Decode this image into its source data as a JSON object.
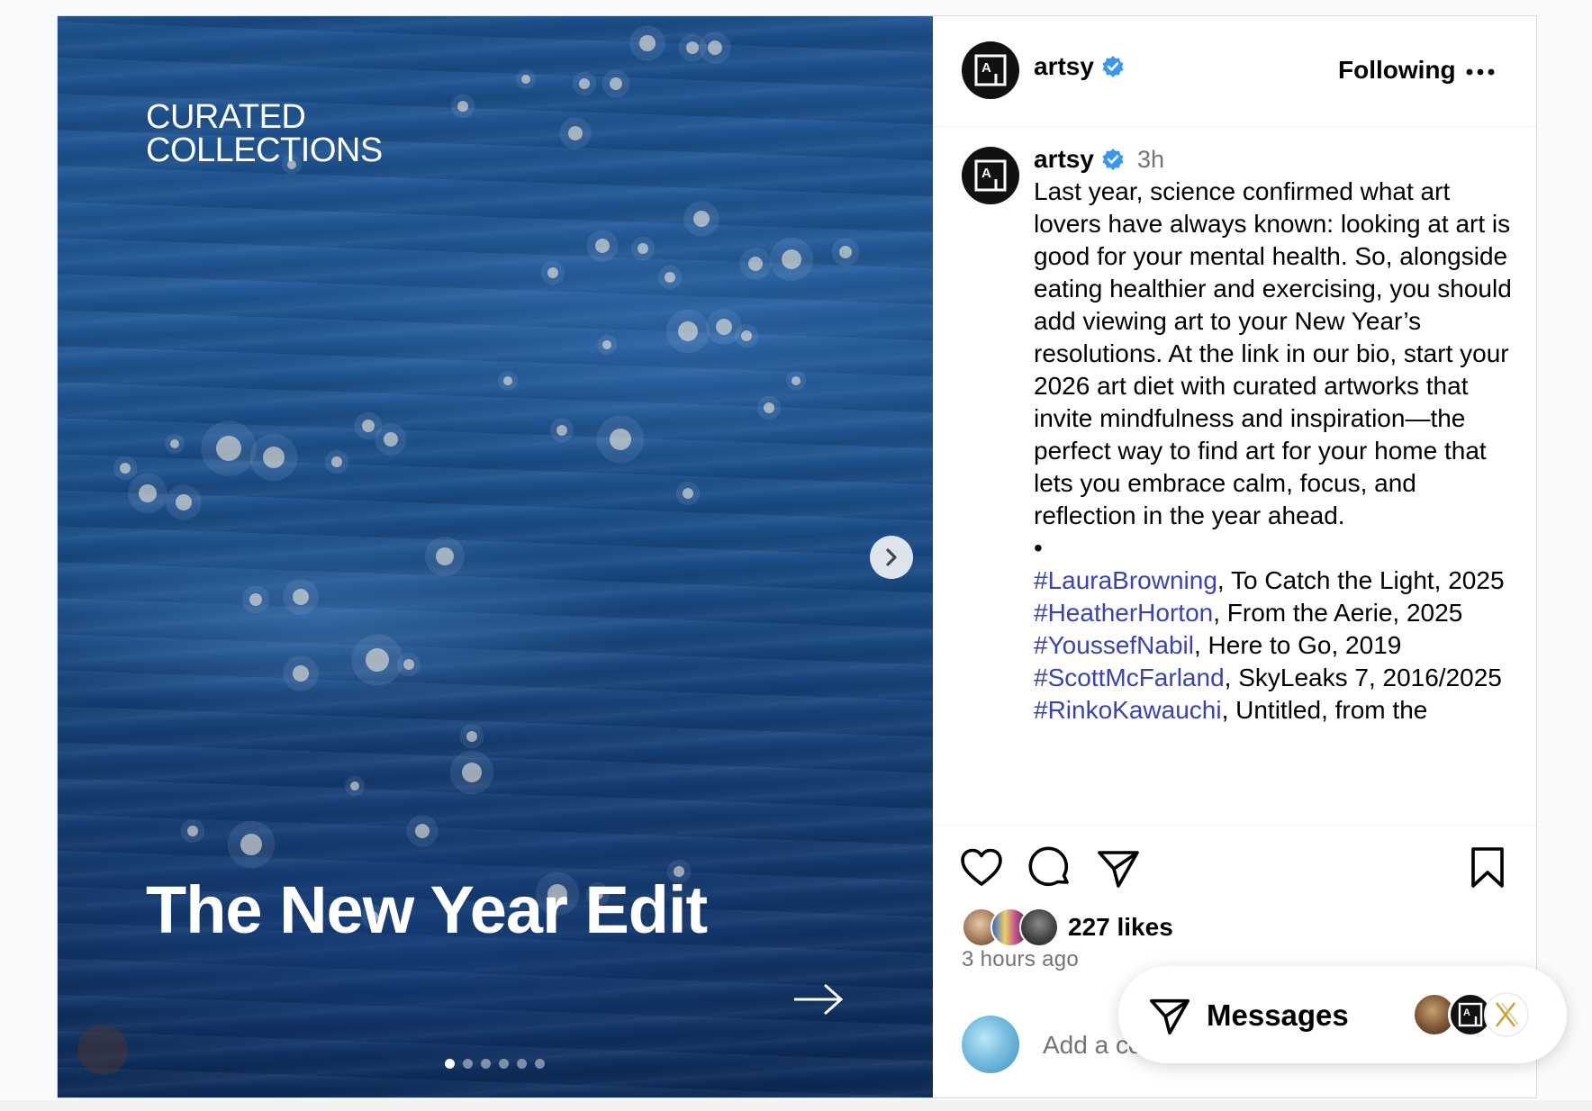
{
  "media": {
    "kicker_line1": "CURATED",
    "kicker_line2": "COLLECTIONS",
    "title": "The New Year Edit",
    "carousel_total": 6,
    "carousel_active_index": 0
  },
  "header": {
    "username": "artsy",
    "verified": true,
    "follow_state": "Following",
    "more_icon": "more-horizontal-icon"
  },
  "caption": {
    "username": "artsy",
    "timestamp": "3h",
    "body": "Last year, science confirmed what art lovers have always known: looking at art is good for your mental health. So, alongside eating healthier and exercising, you should add viewing art to your New Year’s resolutions. At the link in our bio, start your 2026 art diet with curated artworks that invite mindfulness and inspiration—the perfect way to find art for your home that lets you embrace calm, focus, and reflection in the year ahead.",
    "separator": "•",
    "credits": [
      {
        "hashtag": "#LauraBrowning",
        "text": ", To Catch the Light, 2025"
      },
      {
        "hashtag": "#HeatherHorton",
        "text": ", From the Aerie, 2025"
      },
      {
        "hashtag": "#YoussefNabil",
        "text": ", Here to Go, 2019"
      },
      {
        "hashtag": "#ScottMcFarland",
        "text": ", SkyLeaks 7, 2016/2025"
      },
      {
        "hashtag": "#RinkoKawauchi",
        "text": ", Untitled, from the"
      }
    ]
  },
  "actions": {
    "like_icon": "heart-icon",
    "comment_icon": "comment-icon",
    "share_icon": "send-icon",
    "save_icon": "bookmark-icon"
  },
  "likes": {
    "count_label": "227 likes"
  },
  "time_ago": "3 hours ago",
  "comment": {
    "placeholder": "Add a comment…"
  },
  "messages": {
    "label": "Messages"
  },
  "colors": {
    "hashtag": "#3a42b6",
    "verified": "#3897f0",
    "muted": "#737373"
  }
}
